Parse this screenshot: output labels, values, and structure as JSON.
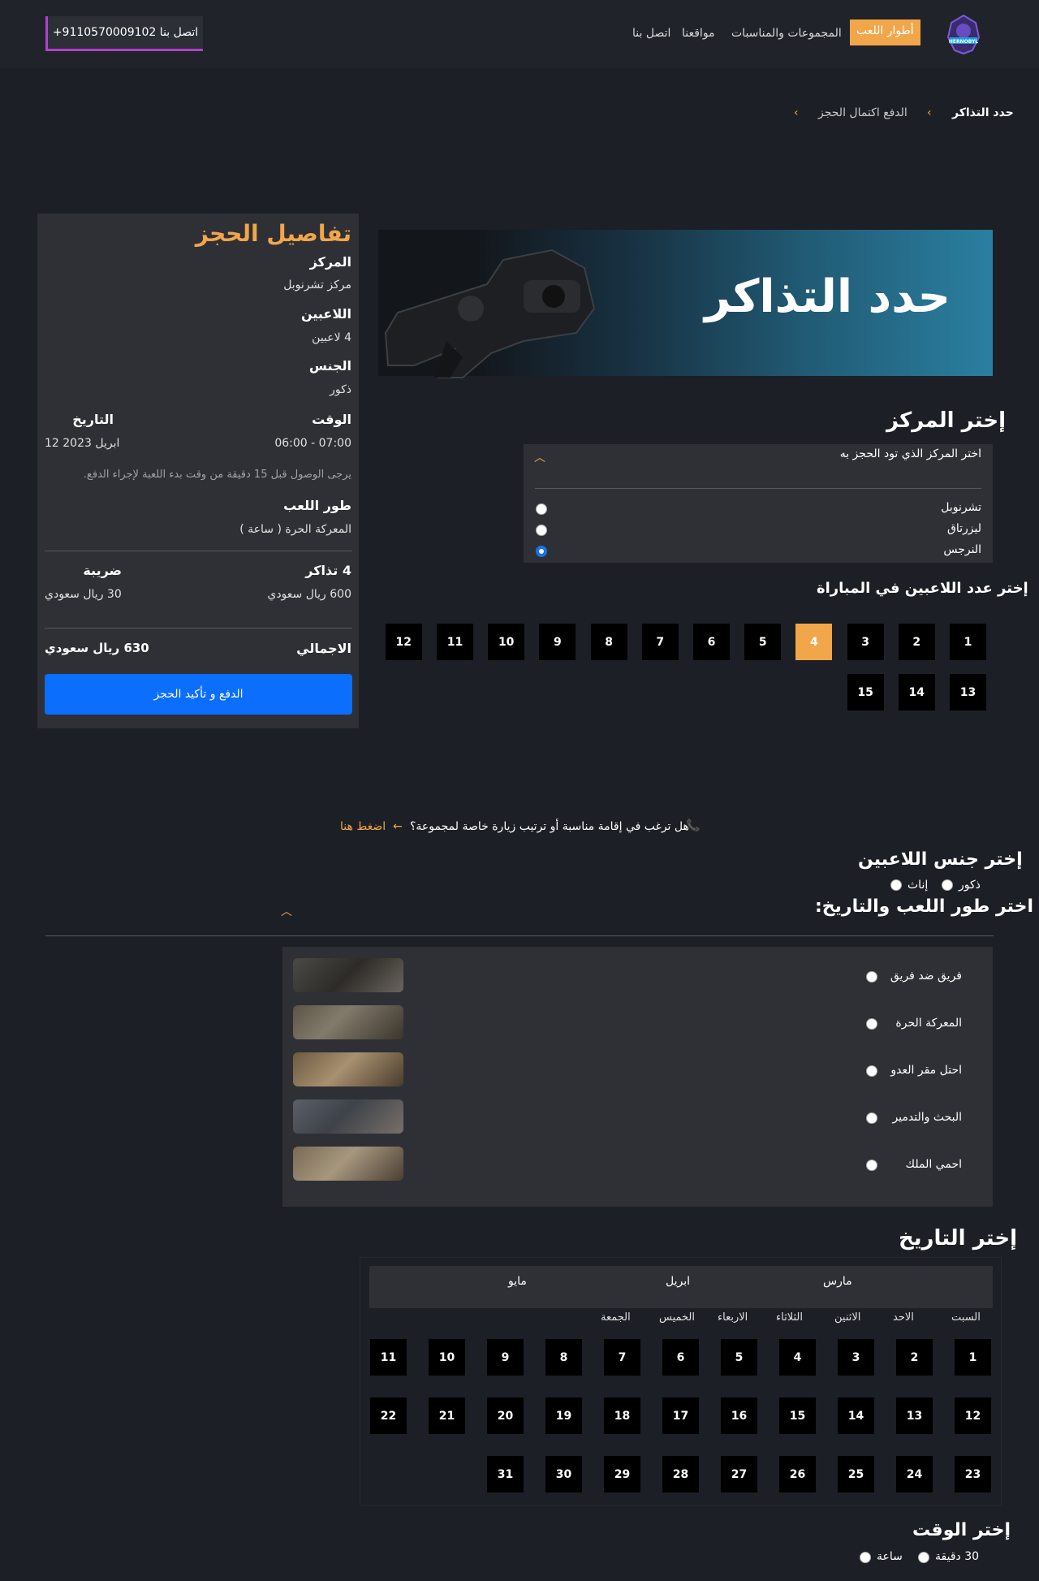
{
  "header": {
    "logo_text": "HERNOBYL",
    "nav": [
      {
        "label": "أطوار اللعب",
        "active": true
      },
      {
        "label": "المجموعات والمناسبات"
      },
      {
        "label": "مواقعنا"
      },
      {
        "label": "اتصل بنا"
      }
    ],
    "contact_button": "+9110570009102 اتصل بنا"
  },
  "breadcrumb": {
    "items": [
      "حدد التذاكر",
      "الدفع اكتمال الحجز"
    ]
  },
  "hero": {
    "title": "حدد التذاكر"
  },
  "center": {
    "heading": "إختر المركز",
    "prompt": "اختر المركز الذي تود الحجز به",
    "options": [
      "تشرنوبل",
      "ليزرتاق",
      "النرجس"
    ],
    "selected_index": 2
  },
  "players": {
    "heading": "إختر عدد اللاعبين في المباراة",
    "numbers": [
      "1",
      "2",
      "3",
      "4",
      "5",
      "6",
      "7",
      "8",
      "9",
      "10",
      "11",
      "12",
      "13",
      "14",
      "15"
    ],
    "selected": "4"
  },
  "summary": {
    "title": "تفاصيل الحجز",
    "center_label": "المركز",
    "center_value": "مركز تشرنوبل",
    "players_label": "اللاعبين",
    "players_value": "4 لاعبين",
    "gender_label": "الجنس",
    "gender_value": "ذكور",
    "time_label": "الوقت",
    "time_value": "07:00 - 06:00",
    "date_label": "التاريخ",
    "date_value": "12 ابريل 2023",
    "note": "يرجى الوصول قبل 15 دقيقة من وقت بدء اللعبة لإجراء الدفع.",
    "mode_label": "طور اللعب",
    "mode_value": "المعركة الحرة ( ساعة )",
    "tickets_label": "4 تذاكر",
    "tickets_value": "600 ريال سعودي",
    "tax_label": "ضريبة",
    "tax_value": "30 ريال سعودي",
    "total_label": "الاجمالي",
    "total_value": "630 ريال سعودي",
    "pay_button": "الدفع و تأكيد الحجز"
  },
  "group": {
    "question": "هل ترغب في إقامة مناسبة أو ترتيب زيارة خاصة لمجموعة؟",
    "link": "اضغط هنا"
  },
  "gender": {
    "heading": "إختر جنس اللاعبين",
    "options": [
      "ذكور",
      "إناث"
    ]
  },
  "modes": {
    "heading": "اختر طور اللعب والتاريخ:",
    "items": [
      "فريق ضد فريق",
      "المعركة الحرة",
      "احتل مقر العدو",
      "البحث والتدمير",
      "احمي الملك"
    ]
  },
  "calendar": {
    "heading": "إختر التاريخ",
    "months": [
      "مارس",
      "ابريل",
      "مايو"
    ],
    "weekdays": [
      "السبت",
      "الاحد",
      "الاثنين",
      "الثلاثاء",
      "الاربعاء",
      "الخميس",
      "الجمعة"
    ],
    "days": [
      "1",
      "2",
      "3",
      "4",
      "5",
      "6",
      "7",
      "8",
      "9",
      "10",
      "11",
      "12",
      "13",
      "14",
      "15",
      "16",
      "17",
      "18",
      "19",
      "20",
      "21",
      "22",
      "23",
      "24",
      "25",
      "26",
      "27",
      "28",
      "29",
      "30",
      "31"
    ]
  },
  "time": {
    "heading": "إختر الوقت",
    "options": [
      "30 دقيقة",
      "ساعة"
    ]
  },
  "colors": {
    "accent": "#f2a64a",
    "primary_button": "#0b6efd",
    "background": "#1c1f25",
    "panel": "#2e3035"
  }
}
